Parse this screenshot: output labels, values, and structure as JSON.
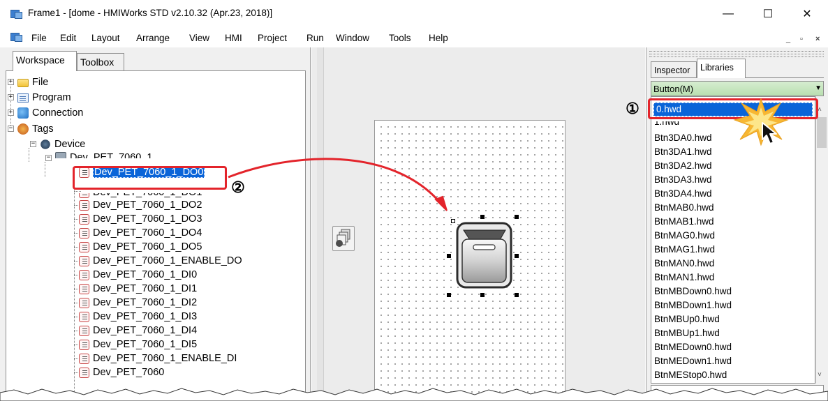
{
  "window": {
    "title": "Frame1 - [dome - HMIWorks STD v2.10.32 (Apr.23, 2018)]",
    "controls": {
      "minimize": "—",
      "maximize": "☐",
      "close": "✕"
    }
  },
  "menu": {
    "items": [
      "File",
      "Edit",
      "Layout",
      "Arrange",
      "View",
      "HMI",
      "Project",
      "Run",
      "Window",
      "Tools",
      "Help"
    ],
    "mdi_controls": [
      "_",
      "▫",
      "×"
    ]
  },
  "left_panel": {
    "tabs": [
      "Workspace",
      "Toolbox"
    ],
    "active_tab": "Workspace",
    "tree": {
      "file": "File",
      "program": "Program",
      "connection": "Connection",
      "tags": "Tags",
      "device": "Device",
      "device_node": "Dev_PET_7060_1",
      "selected_tag": "Dev_PET_7060_1_DO0",
      "partial_tag": "Dev_PET_7060_1_DO1",
      "tags_list": [
        "Dev_PET_7060_1_DO2",
        "Dev_PET_7060_1_DO3",
        "Dev_PET_7060_1_DO4",
        "Dev_PET_7060_1_DO5",
        "Dev_PET_7060_1_ENABLE_DO",
        "Dev_PET_7060_1_DI0",
        "Dev_PET_7060_1_DI1",
        "Dev_PET_7060_1_DI2",
        "Dev_PET_7060_1_DI3",
        "Dev_PET_7060_1_DI4",
        "Dev_PET_7060_1_DI5",
        "Dev_PET_7060_1_ENABLE_DI"
      ],
      "cut_tag": "Dev_PET_7060"
    }
  },
  "right_panel": {
    "tabs": [
      "Inspector",
      "Libraries"
    ],
    "active_tab": "Libraries",
    "category": "Button(M)",
    "selected_item": "0.hwd",
    "partial_item": "1.hwd",
    "items": [
      "Btn3DA0.hwd",
      "Btn3DA1.hwd",
      "Btn3DA2.hwd",
      "Btn3DA3.hwd",
      "Btn3DA4.hwd",
      "BtnMAB0.hwd",
      "BtnMAB1.hwd",
      "BtnMAG0.hwd",
      "BtnMAG1.hwd",
      "BtnMAN0.hwd",
      "BtnMAN1.hwd",
      "BtnMBDown0.hwd",
      "BtnMBDown1.hwd",
      "BtnMBUp0.hwd",
      "BtnMBUp1.hwd",
      "BtnMEDown0.hwd",
      "BtnMEDown1.hwd",
      "BtnMEStop0.hwd"
    ]
  },
  "callouts": {
    "step1": "①",
    "step2": "②"
  },
  "colors": {
    "selection": "#0a64d8",
    "callout_red": "#e3242b",
    "combo_green": "#c6e6be",
    "burst_yellow": "#f7b733"
  }
}
